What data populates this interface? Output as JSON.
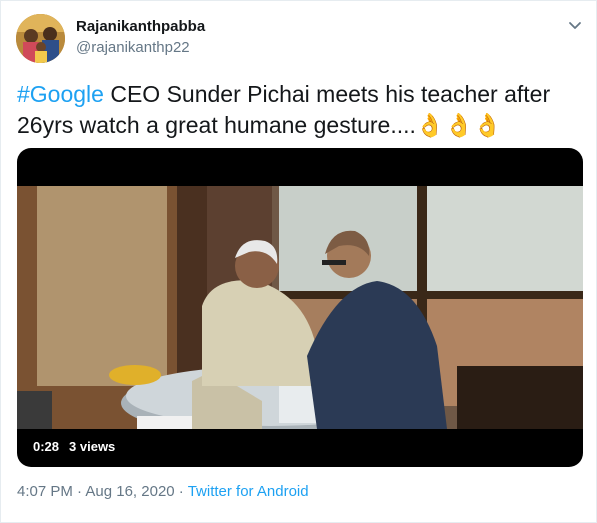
{
  "tweet": {
    "display_name": "Rajanikanthpabba",
    "handle": "@rajanikanthp22",
    "hashtag": "#Google",
    "text_line1": " CEO Sunder Pichai meets his teacher after",
    "text_line2": "26yrs watch a great humane gesture....",
    "emoji": "👌👌👌",
    "video": {
      "duration": "0:28",
      "views": "3 views"
    },
    "time": "4:07 PM",
    "separator": " · ",
    "date": "Aug 16, 2020",
    "source": "Twitter for Android"
  },
  "icons": {
    "menu": "chevron-down-icon",
    "avatar": "profile-photo"
  },
  "colors": {
    "link": "#1da1f2",
    "secondary_text": "#657786",
    "primary_text": "#14171a"
  }
}
